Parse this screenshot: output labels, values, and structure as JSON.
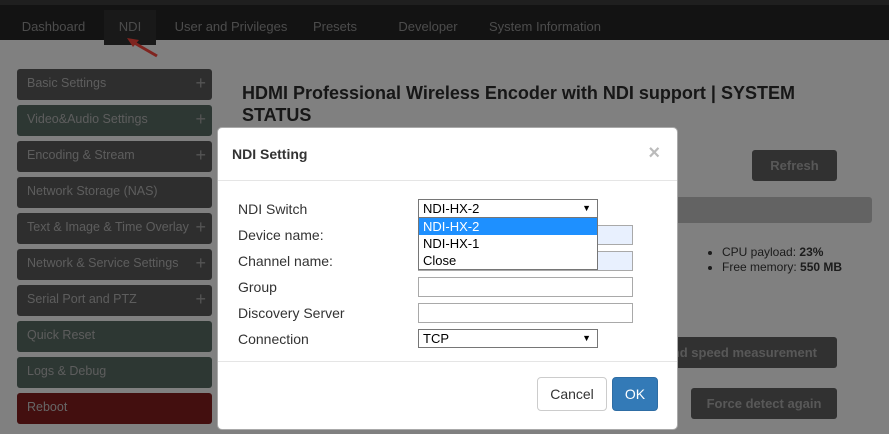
{
  "nav": {
    "tabs": [
      {
        "label": "Dashboard"
      },
      {
        "label": "NDI"
      },
      {
        "label": "User and Privileges"
      },
      {
        "label": "Presets"
      },
      {
        "label": "Developer"
      },
      {
        "label": "System Information"
      }
    ],
    "active": "NDI"
  },
  "sidebar": {
    "items": [
      {
        "label": "Basic Settings",
        "expandable": true
      },
      {
        "label": "Video&Audio Settings",
        "expandable": true
      },
      {
        "label": "Encoding & Stream",
        "expandable": true
      },
      {
        "label": "Network Storage (NAS)",
        "expandable": false
      },
      {
        "label": "Text & Image & Time Overlay",
        "expandable": true
      },
      {
        "label": "Network & Service Settings",
        "expandable": true
      },
      {
        "label": "Serial Port and PTZ",
        "expandable": true
      },
      {
        "label": "Quick Reset",
        "expandable": false
      },
      {
        "label": "Logs & Debug",
        "expandable": false
      },
      {
        "label": "Reboot",
        "expandable": false
      }
    ],
    "plus_symbol": "+"
  },
  "main": {
    "title": "HDMI Professional Wireless Encoder with NDI support | SYSTEM STATUS",
    "refresh_label": "Refresh",
    "speed_label": "And speed measurement",
    "force_label": "Force detect again",
    "stats": {
      "cpu_label": "CPU payload:",
      "cpu_value": "23%",
      "mem_label": "Free memory:",
      "mem_value": "550 MB"
    }
  },
  "modal": {
    "title": "NDI Setting",
    "close_symbol": "×",
    "fields": {
      "ndi_switch_label": "NDI Switch",
      "ndi_switch_value": "NDI-HX-2",
      "ndi_switch_options": [
        "NDI-HX-2",
        "NDI-HX-1",
        "Close"
      ],
      "device_name_label": "Device name:",
      "channel_name_label": "Channel name:",
      "group_label": "Group",
      "discovery_label": "Discovery Server",
      "connection_label": "Connection",
      "connection_value": "TCP"
    },
    "cancel_label": "Cancel",
    "ok_label": "OK"
  },
  "colors": {
    "accent": "#337ab7",
    "dropdown_highlight": "#1e90ff",
    "reboot": "#7a1d1d",
    "arrow": "#e8423a"
  }
}
